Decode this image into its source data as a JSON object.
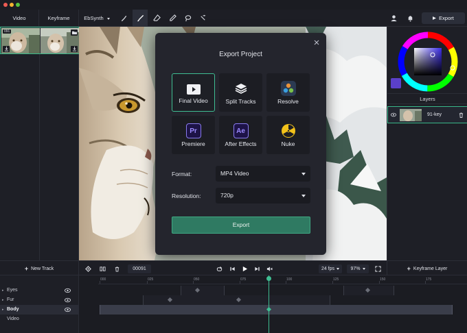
{
  "window": {
    "dots": [
      "#ee5b53",
      "#f2b230",
      "#55c33f"
    ]
  },
  "topbar": {
    "tabs": [
      "Video",
      "Keyframe"
    ],
    "mode_select": "EbSynth",
    "export_label": "Export"
  },
  "left_panel": {
    "frame_number": "091"
  },
  "right_panel": {
    "layers_title": "Layers",
    "layer_name": "91-key",
    "swatch_color": "#5b40c9"
  },
  "modal": {
    "title": "Export Project",
    "options": [
      {
        "label": "Final Video",
        "icon": "play-icon",
        "selected": true
      },
      {
        "label": "Split Tracks",
        "icon": "layers-icon",
        "selected": false
      },
      {
        "label": "Resolve",
        "icon": "davinci-resolve-icon",
        "selected": false
      },
      {
        "label": "Premiere",
        "icon": "premiere-icon",
        "icon_text": "Pr",
        "selected": false
      },
      {
        "label": "After Effects",
        "icon": "after-effects-icon",
        "icon_text": "Ae",
        "selected": false
      },
      {
        "label": "Nuke",
        "icon": "nuke-icon",
        "selected": false
      }
    ],
    "format_label": "Format:",
    "format_value": "MP4 Video",
    "resolution_label": "Resolution:",
    "resolution_value": "720p",
    "export_button": "Export",
    "accent": "#2f7a62"
  },
  "timeline": {
    "new_track": "New Track",
    "frame_counter": "00091",
    "fps": "24 fps",
    "zoom": "97%",
    "keyframe_layer": "Keyframe Layer",
    "ruler_labels": [
      "000",
      "025",
      "050",
      "075",
      "100",
      "125",
      "150",
      "175"
    ],
    "tracks": [
      "Eyes",
      "Fur",
      "Body",
      "Video"
    ]
  }
}
